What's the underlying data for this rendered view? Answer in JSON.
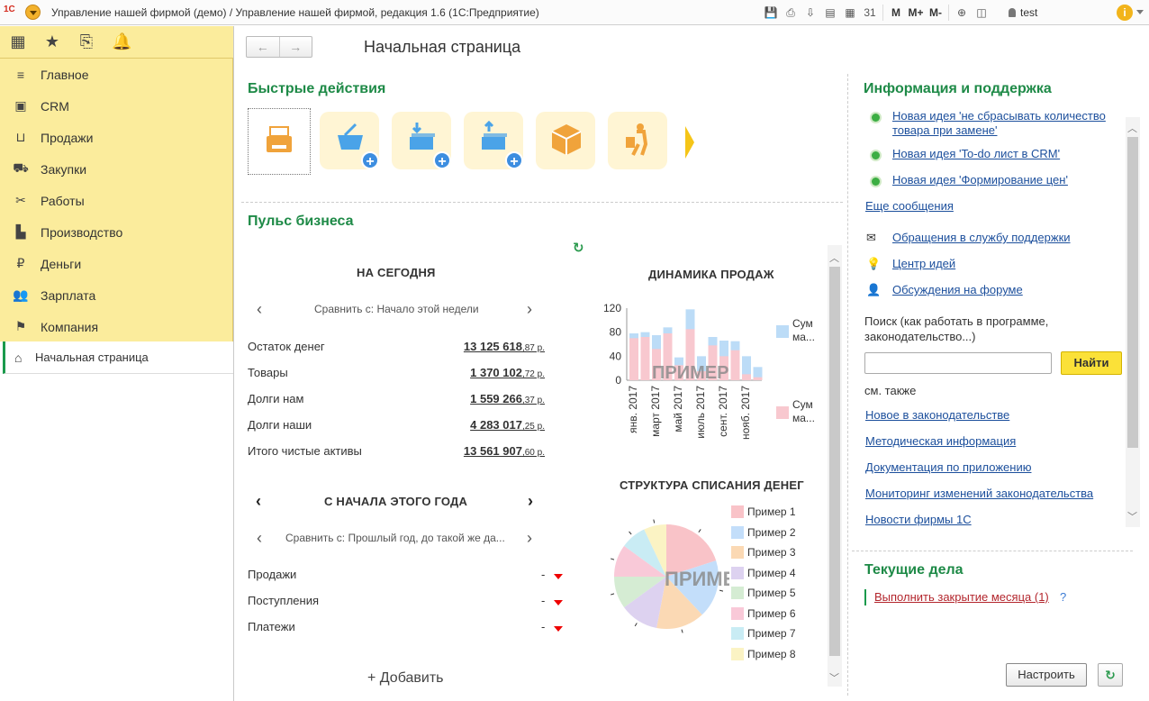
{
  "titlebar": {
    "title": "Управление нашей фирмой (демо) / Управление нашей фирмой, редакция 1.6   (1С:Предприятие)",
    "logo": "1С",
    "user": "test",
    "toolbar": [
      {
        "name": "save-icon",
        "glyph": "💾"
      },
      {
        "name": "print-icon",
        "glyph": "⎙"
      },
      {
        "name": "download-icon",
        "glyph": "⇩"
      },
      {
        "name": "print-preview-icon",
        "glyph": "▤"
      },
      {
        "name": "calculator-icon",
        "glyph": "▦"
      },
      {
        "name": "calendar-icon",
        "glyph": "31"
      },
      {
        "name": "memory-m-icon",
        "glyph": "M"
      },
      {
        "name": "memory-m-plus-icon",
        "glyph": "M+"
      },
      {
        "name": "memory-m-minus-icon",
        "glyph": "M-"
      },
      {
        "name": "zoom-icon",
        "glyph": "⊕"
      },
      {
        "name": "panels-icon",
        "glyph": "◫"
      }
    ]
  },
  "sidebar": {
    "top_icons": [
      {
        "name": "apps-grid-icon",
        "glyph": "▦"
      },
      {
        "name": "favorites-star-icon",
        "glyph": "★"
      },
      {
        "name": "history-icon",
        "glyph": "⎘"
      },
      {
        "name": "notifications-bell-icon",
        "glyph": "🔔"
      }
    ],
    "items": [
      {
        "label": "Главное",
        "icon": "menu-lines-icon",
        "glyph": "≡"
      },
      {
        "label": "CRM",
        "icon": "crm-card-icon",
        "glyph": "▣"
      },
      {
        "label": "Продажи",
        "icon": "sales-basket-icon",
        "glyph": "⊔"
      },
      {
        "label": "Закупки",
        "icon": "purchases-cart-icon",
        "glyph": "⛟"
      },
      {
        "label": "Работы",
        "icon": "works-tools-icon",
        "glyph": "✂"
      },
      {
        "label": "Производство",
        "icon": "production-factory-icon",
        "glyph": "▙"
      },
      {
        "label": "Деньги",
        "icon": "money-coin-icon",
        "glyph": "₽"
      },
      {
        "label": "Зарплата",
        "icon": "salary-people-icon",
        "glyph": "👥"
      },
      {
        "label": "Компания",
        "icon": "company-flag-icon",
        "glyph": "⚑"
      }
    ],
    "current": {
      "label": "Начальная страница",
      "icon": "home-icon",
      "glyph": "⌂"
    }
  },
  "main": {
    "title": "Начальная страница",
    "quick_actions_title": "Быстрые действия",
    "quick_actions": [
      {
        "name": "cash-register-action",
        "color": "#f0a33b"
      },
      {
        "name": "sales-basket-add-action",
        "color": "#4aa3e8"
      },
      {
        "name": "money-incoming-add-action",
        "color": "#4aa3e8"
      },
      {
        "name": "money-outgoing-add-action",
        "color": "#4aa3e8"
      },
      {
        "name": "package-box-action",
        "color": "#f0a33b"
      },
      {
        "name": "traveler-bag-action",
        "color": "#f0a33b"
      }
    ],
    "pulse_title": "Пульс бизнеса",
    "today": {
      "heading": "НА СЕГОДНЯ",
      "compare": "Сравнить с: Начало этой недели",
      "rows": [
        {
          "label": "Остаток денег",
          "value": "13 125 618",
          "cents": ",87 р."
        },
        {
          "label": "Товары",
          "value": "1 370 102",
          "cents": ",72 р."
        },
        {
          "label": "Долги нам",
          "value": "1 559 266",
          "cents": ",37 р."
        },
        {
          "label": "Долги наши",
          "value": "4 283 017",
          "cents": ",25 р."
        },
        {
          "label": "Итого чистые активы",
          "value": "13 561 907",
          "cents": ",60 р."
        }
      ]
    },
    "year": {
      "heading": "С НАЧАЛА ЭТОГО ГОДА",
      "compare": "Сравнить с: Прошлый год, до такой же да...",
      "rows": [
        {
          "label": "Продажи",
          "value": "-"
        },
        {
          "label": "Поступления",
          "value": "-"
        },
        {
          "label": "Платежи",
          "value": "-"
        }
      ]
    },
    "add_label": "+ Добавить"
  },
  "chart_data": [
    {
      "type": "bar",
      "title": "ДИНАМИКА ПРОДАЖ",
      "watermark": "ПРИМЕР",
      "categories": [
        "янв. 2017",
        "",
        "март 2017",
        "",
        "май 2017",
        "",
        "июль 2017",
        "",
        "сент. 2017",
        "",
        "нояб. 2017",
        ""
      ],
      "series": [
        {
          "name": "Сум ма...",
          "color": "#bcdcf7",
          "values": [
            78,
            80,
            75,
            88,
            38,
            118,
            40,
            72,
            66,
            65,
            40,
            22
          ]
        },
        {
          "name": "Сум ма...",
          "color": "#f8c8cf",
          "values": [
            70,
            72,
            52,
            78,
            25,
            85,
            15,
            58,
            40,
            50,
            10,
            5
          ]
        }
      ],
      "ylim": [
        0,
        120
      ],
      "yticks": [
        0,
        40,
        80,
        120
      ]
    },
    {
      "type": "pie",
      "title": "СТРУКТУРА СПИСАНИЯ ДЕНЕГ",
      "watermark": "ПРИМЕР",
      "labels": [
        "Пример 1",
        "Пример 2",
        "Пример 3",
        "Пример 4",
        "Пример 5",
        "Пример 6",
        "Пример 7",
        "Пример 8"
      ],
      "values": [
        20,
        18,
        15,
        12,
        10,
        10,
        8,
        7
      ],
      "colors": [
        "#f9c3c8",
        "#c3defa",
        "#fbd9b4",
        "#ddd2f0",
        "#d5ecd3",
        "#f9c9d8",
        "#c9ecf4",
        "#fbf3c4"
      ]
    }
  ],
  "right": {
    "info_title": "Информация и поддержка",
    "news": [
      "Новая идея 'не сбрасывать количество товара при замене'",
      "Новая идея 'To-do лист в CRM'",
      "Новая идея 'Формирование цен'"
    ],
    "more": "Еще сообщения",
    "support": [
      {
        "label": "Обращения в службу поддержки",
        "icon": "mail-icon",
        "glyph": "✉"
      },
      {
        "label": "Центр идей",
        "icon": "idea-bulb-icon",
        "glyph": "💡"
      },
      {
        "label": "Обсуждения на форуме",
        "icon": "forum-user-icon",
        "glyph": "👤"
      }
    ],
    "search_label": "Поиск (как работать в программе, законодательство...)",
    "search_value": "",
    "find_button": "Найти",
    "see_also": "см. также",
    "links": [
      "Новое в законодательстве",
      "Методическая информация",
      "Документация по приложению",
      "Мониторинг изменений законодательства",
      "Новости фирмы 1С"
    ],
    "tasks_title": "Текущие дела",
    "task": "Выполнить закрытие месяца (1)",
    "task_help": "?",
    "setup_button": "Настроить"
  }
}
